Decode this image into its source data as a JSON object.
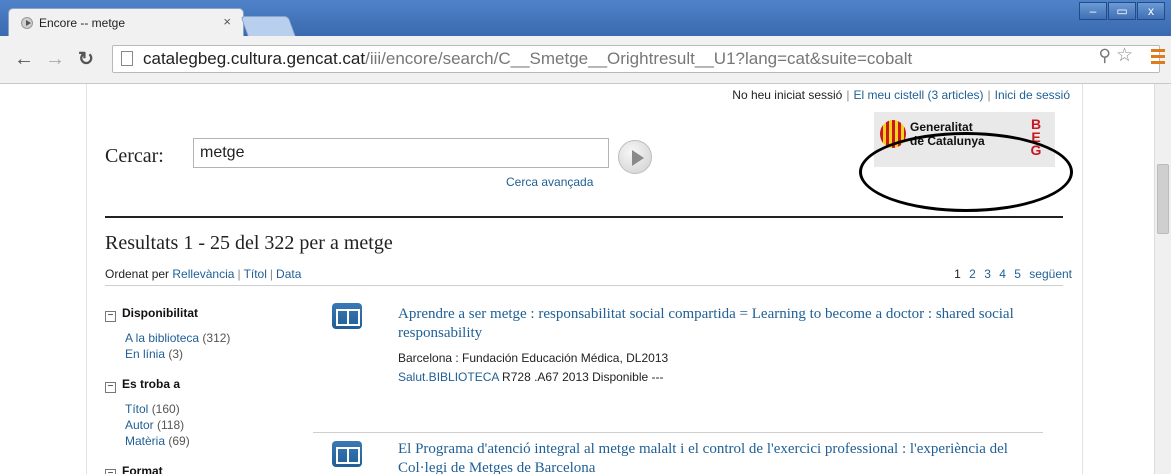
{
  "browser": {
    "tab_title": "Encore -- metge",
    "tab_close": "×",
    "window_controls": [
      "–",
      "▭",
      "x"
    ],
    "url_host": "catalegbeg.cultura.gencat.cat",
    "url_path": "/iii/encore/search/C__Smetge__Orightresult__U1?lang=cat&suite=cobalt"
  },
  "header": {
    "login_status": "No heu iniciat sessió",
    "cart_link": "El meu cistell (3 articles)",
    "login_link": "Inici de sessió",
    "logo_name": "Generalitat\nde Catalunya",
    "logo_letters": [
      "B",
      "E",
      "G"
    ]
  },
  "search": {
    "label": "Cercar:",
    "value": "metge",
    "advanced_link": "Cerca avançada"
  },
  "results": {
    "heading": "Resultats 1 - 25 del 322 per a metge",
    "sort_label": "Ordenat per",
    "sort_options": [
      "Rellevància",
      "Títol",
      "Data"
    ],
    "pages": [
      "1",
      "2",
      "3",
      "4",
      "5"
    ],
    "next_label": "següent"
  },
  "facets": [
    {
      "heading": "Disponibilitat",
      "toggle": "−",
      "items": [
        {
          "label": "A la biblioteca",
          "count": "(312)"
        },
        {
          "label": "En línia",
          "count": "(3)"
        }
      ]
    },
    {
      "heading": "Es troba a",
      "toggle": "−",
      "items": [
        {
          "label": "Títol",
          "count": "(160)"
        },
        {
          "label": "Autor",
          "count": "(118)"
        },
        {
          "label": "Matèria",
          "count": "(69)"
        }
      ]
    },
    {
      "heading": "Format",
      "toggle": "−",
      "items": []
    }
  ],
  "records": [
    {
      "title": "Aprendre a ser metge : responsabilitat social compartida = Learning to become a doctor : shared social responsability",
      "publication": "Barcelona : Fundación Educación Médica, DL2013",
      "location": "Salut.BIBLIOTECA",
      "holding": " R728 .A67 2013 Disponible ---"
    },
    {
      "title": "El Programa d'atenció integral al metge malalt i el control de l'exercici professional : l'experiència del Col·legi de Metges de Barcelona",
      "publication": "",
      "location": "",
      "holding": ""
    }
  ]
}
